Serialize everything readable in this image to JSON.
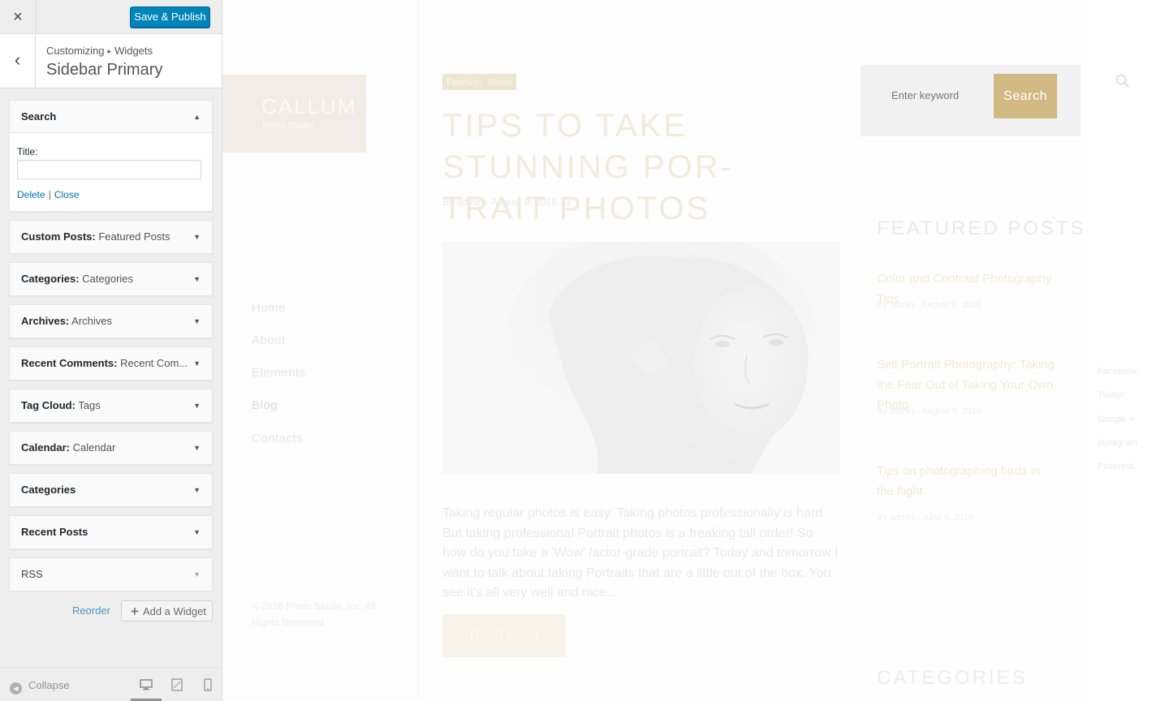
{
  "customizer": {
    "close_icon": "×",
    "publish_label": "Save & Publish",
    "back_icon": "‹",
    "breadcrumb": {
      "root": "Customizing",
      "separator": "▸",
      "section": "Widgets"
    },
    "title": "Sidebar Primary",
    "search_widget": {
      "name": "Search",
      "title_label": "Title:",
      "title_value": "",
      "delete_label": "Delete",
      "pipe": "|",
      "close_label": "Close",
      "toggle": "▲"
    },
    "widgets": [
      {
        "name": "Custom Posts:",
        "subtitle": "Featured Posts",
        "toggle": "▼"
      },
      {
        "name": "Categories:",
        "subtitle": "Categories",
        "toggle": "▼"
      },
      {
        "name": "Archives:",
        "subtitle": "Archives",
        "toggle": "▼"
      },
      {
        "name": "Recent Comments:",
        "subtitle": "Recent Com...",
        "toggle": "▼"
      },
      {
        "name": "Tag Cloud:",
        "subtitle": "Tags",
        "toggle": "▼"
      },
      {
        "name": "Calendar:",
        "subtitle": "Calendar",
        "toggle": "▼"
      },
      {
        "name": "Categories",
        "subtitle": "",
        "toggle": "▼"
      },
      {
        "name": "Recent Posts",
        "subtitle": "",
        "toggle": "▼"
      },
      {
        "name": "RSS",
        "subtitle": "",
        "toggle": "▼"
      }
    ],
    "reorder_label": "Reorder",
    "add_widget_icon": "+",
    "add_widget_label": "Add a Widget",
    "collapse_icon": "◀",
    "collapse_label": "Collapse",
    "devices": [
      "desktop-icon",
      "tablet-icon",
      "mobile-icon"
    ],
    "accent_color": "#0085ba"
  },
  "preview": {
    "logo": {
      "name": "CALLUM",
      "tagline": "Photo Studio"
    },
    "nav": [
      {
        "label": "Home",
        "arrow": "›"
      },
      {
        "label": "About",
        "arrow": ""
      },
      {
        "label": "Elements",
        "arrow": ""
      },
      {
        "label": "Blog",
        "arrow": "›"
      },
      {
        "label": "Contacts",
        "arrow": ""
      }
    ],
    "copyright": "© 2016 Photo Studio, Inc. All Rights Reserved",
    "post": {
      "tags": [
        "Fashion",
        "News"
      ],
      "title": "TIPS TO TAKE STUNNING POR- TRAIT PHOTOS",
      "meta": "By admin - August 9, 2016 - 3",
      "excerpt": "Taking regular photos is easy. Taking photos professionally is hard. But taking professional Portrait photos is a freaking tall order! So how do you take a 'Wow' factor-grade portrait? Today and tomorrow I want to talk about taking Portraits that are a little out of the box. You see it's all very well and nice...",
      "read_more": "Read more"
    },
    "search": {
      "placeholder": "Enter keyword",
      "button": "Search"
    },
    "featured_heading": "FEATURED POSTS",
    "featured": [
      {
        "title": "Color and Contrast Photography Tips",
        "meta": "By admin - August 8, 2016"
      },
      {
        "title": "Self Portrait Photography: Taking the Fear Out of Taking Your Own Photo",
        "meta": "By admin - August 9, 2016"
      },
      {
        "title": "Tips on photographing birds in the flight",
        "meta": "By admin - June 9, 2016"
      }
    ],
    "categories_heading": "CATEGORIES",
    "social": [
      "Facebook",
      "Twitter",
      "Google +",
      "Instagram",
      "Pinterest"
    ],
    "search_icon": "search-icon",
    "accent_color": "#d2b983"
  }
}
